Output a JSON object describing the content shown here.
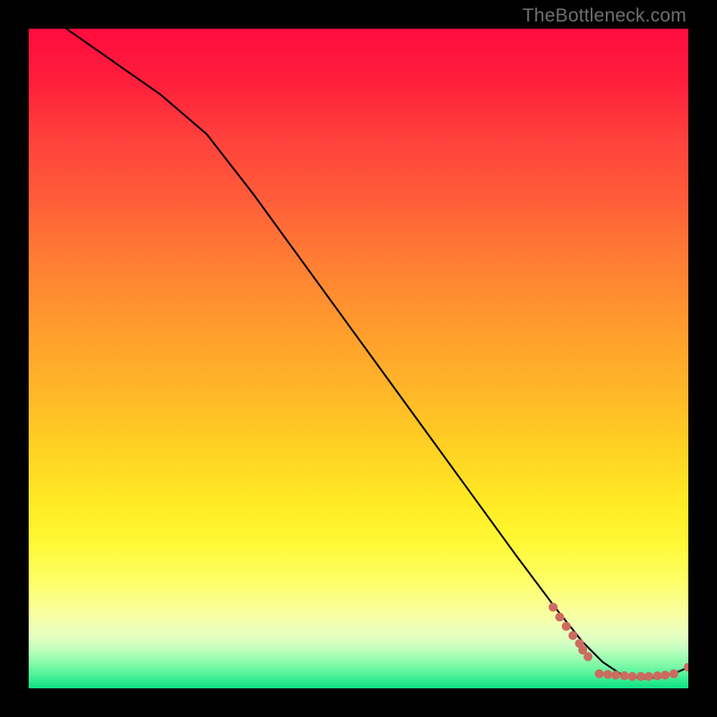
{
  "watermark": "TheBottleneck.com",
  "chart_data": {
    "type": "line",
    "title": "",
    "xlabel": "",
    "ylabel": "",
    "xlim": [
      0,
      100
    ],
    "ylim": [
      0,
      100
    ],
    "grid": false,
    "legend": false,
    "series": [
      {
        "name": "curve",
        "style": "line",
        "color": "#000000",
        "x": [
          0,
          10,
          20,
          27,
          34,
          42,
          50,
          58,
          66,
          74,
          80,
          84,
          87,
          90,
          93,
          96,
          98,
          100
        ],
        "y": [
          104,
          97,
          90,
          84,
          75,
          64,
          53,
          42,
          31,
          20,
          12,
          7,
          4,
          2,
          1.5,
          1.7,
          2.3,
          3.2
        ]
      },
      {
        "name": "markers-descent",
        "style": "scatter",
        "color": "#cc6b60",
        "x": [
          79.5,
          80.5,
          81.5,
          82.5,
          83.5,
          84.0,
          84.8
        ],
        "y": [
          12.3,
          10.8,
          9.4,
          8.0,
          6.8,
          5.8,
          4.8
        ]
      },
      {
        "name": "markers-flat",
        "style": "scatter",
        "color": "#cc6b60",
        "x": [
          86.5,
          87.8,
          89.0,
          90.3,
          91.5,
          92.8,
          94.0,
          95.3,
          96.5,
          97.8
        ],
        "y": [
          2.2,
          2.1,
          2.0,
          1.9,
          1.8,
          1.8,
          1.8,
          1.9,
          2.0,
          2.2
        ]
      },
      {
        "name": "marker-end",
        "style": "scatter",
        "color": "#cc6b60",
        "x": [
          100
        ],
        "y": [
          3.2
        ]
      }
    ]
  }
}
